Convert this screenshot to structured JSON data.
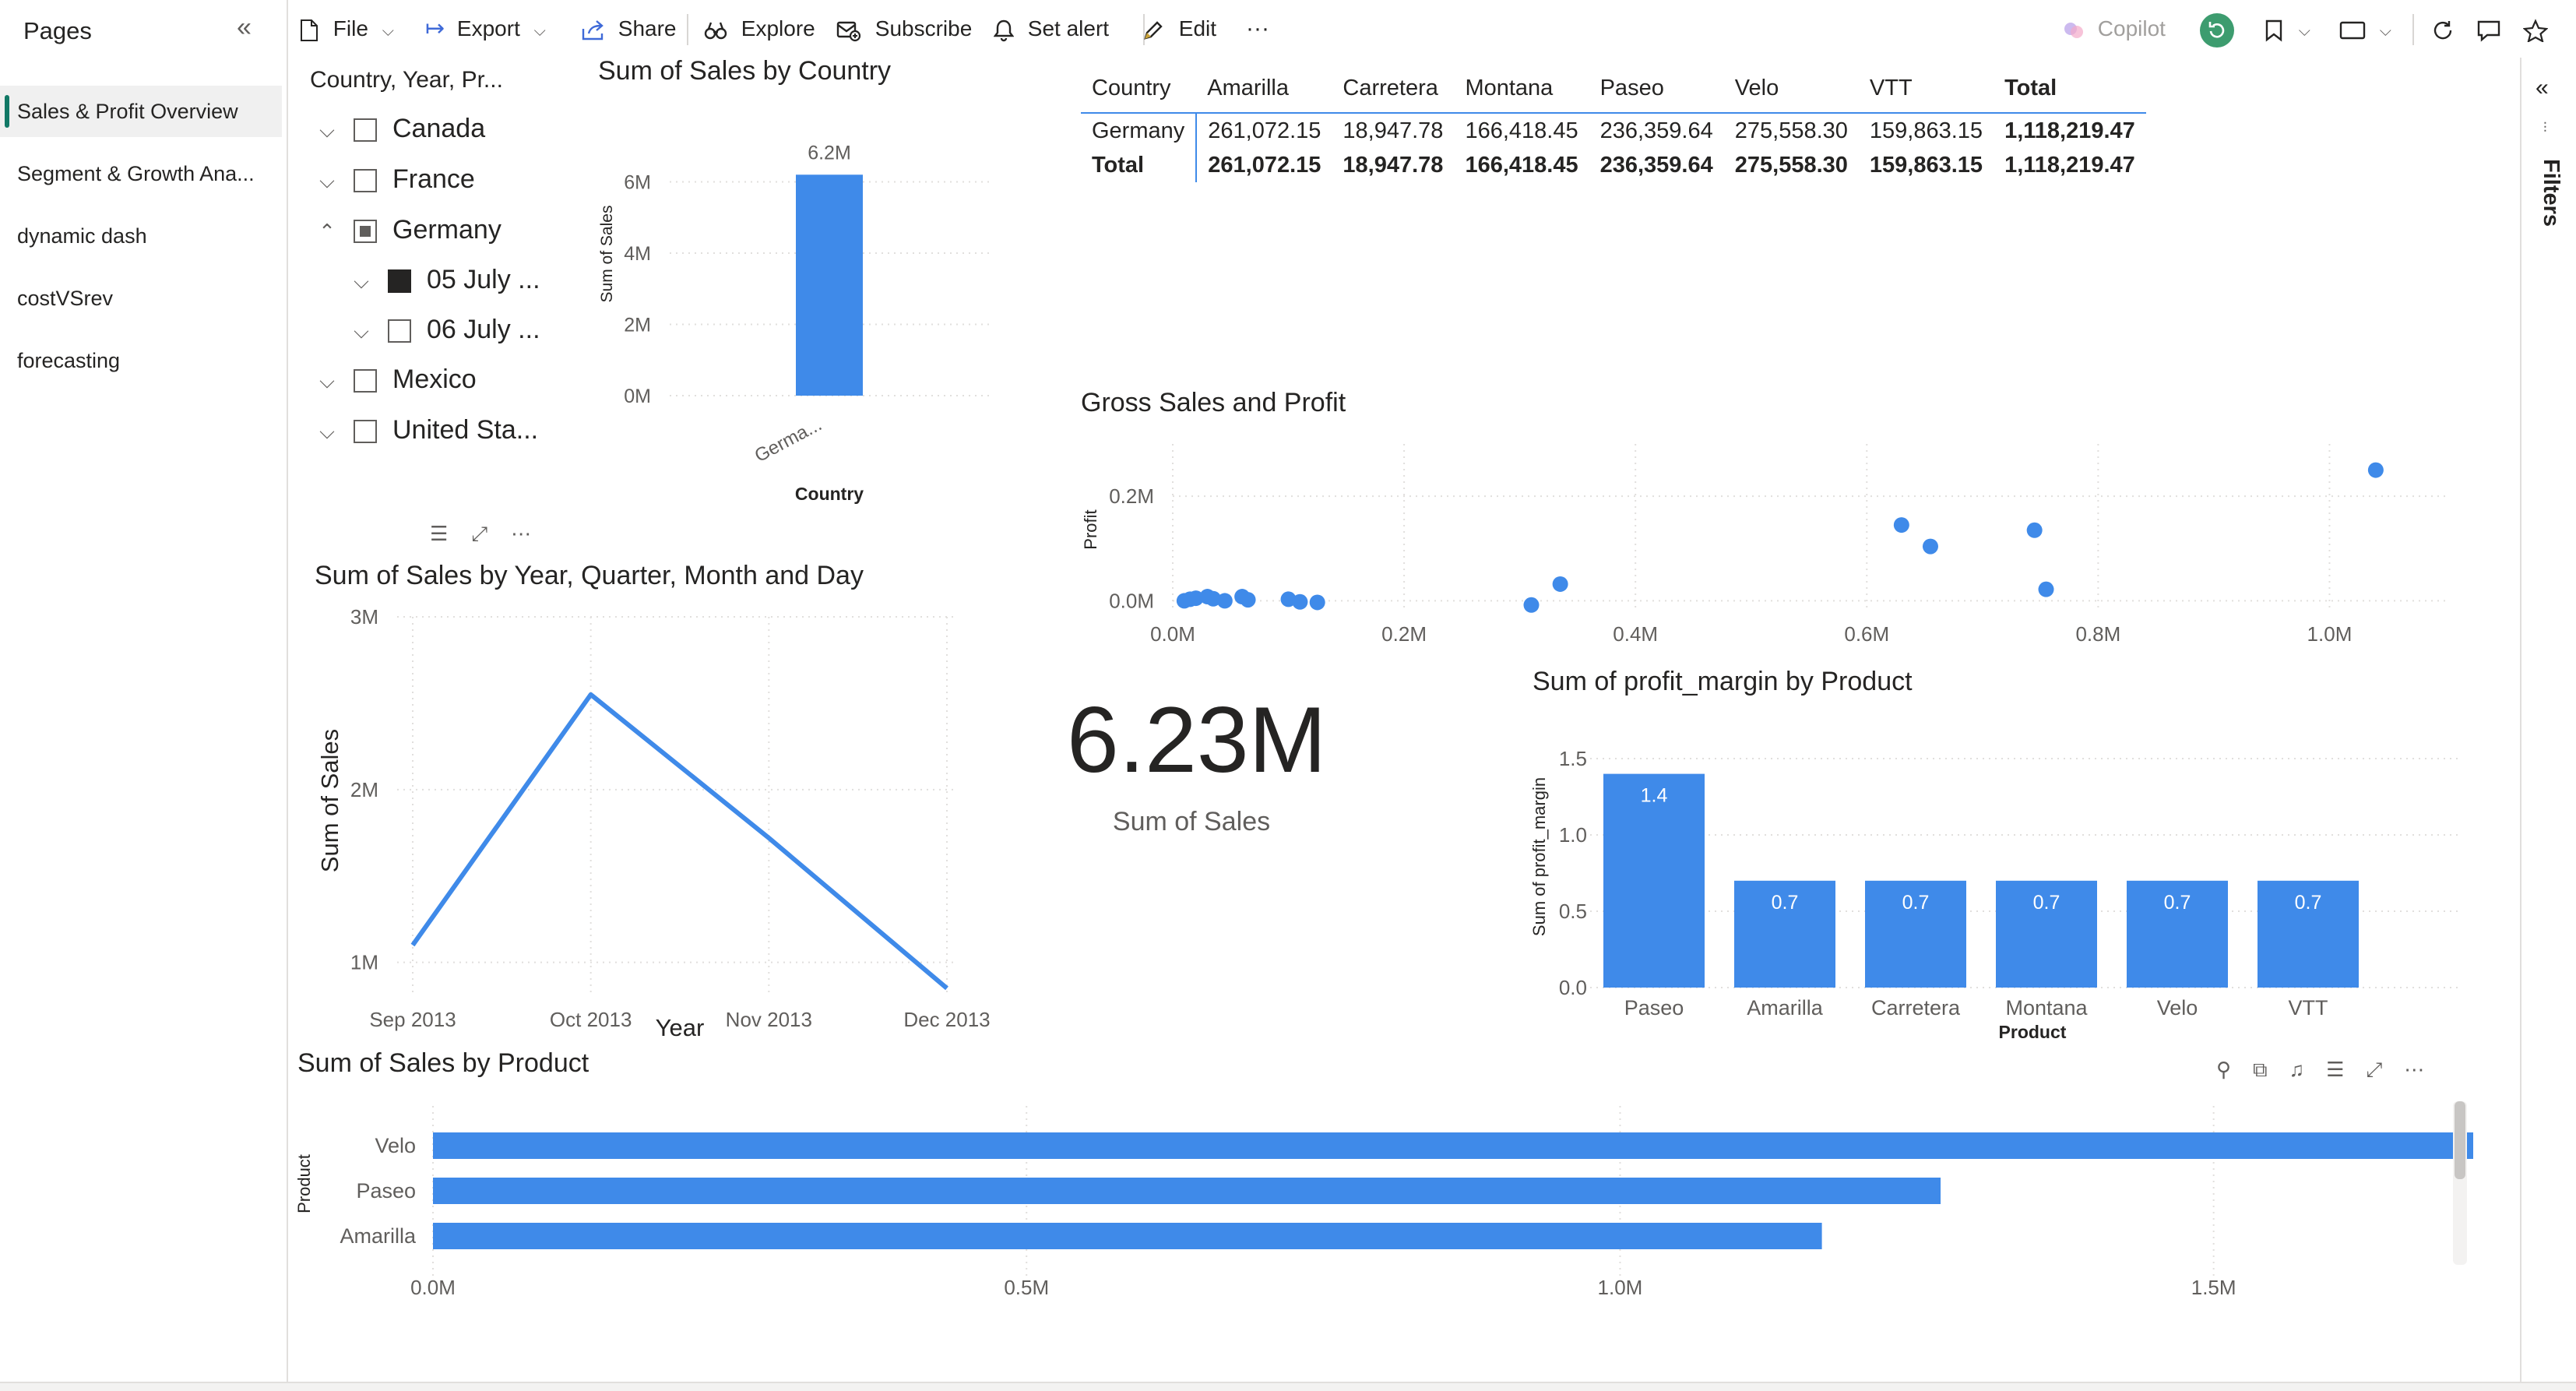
{
  "sidebar": {
    "title": "Pages",
    "pages": [
      {
        "label": "Sales & Profit Overview",
        "active": true
      },
      {
        "label": "Segment & Growth Ana...",
        "active": false
      },
      {
        "label": "dynamic dash",
        "active": false
      },
      {
        "label": "costVSrev",
        "active": false
      },
      {
        "label": "forecasting",
        "active": false
      }
    ]
  },
  "toolbar": {
    "file": "File",
    "export": "Export",
    "share": "Share",
    "explore": "Explore",
    "subscribe": "Subscribe",
    "set_alert": "Set alert",
    "edit": "Edit",
    "more": "···",
    "copilot": "Copilot"
  },
  "filters_pane": {
    "label": "Filters"
  },
  "slicer": {
    "header": "Country, Year, Pr...",
    "items": [
      {
        "label": "Canada",
        "level": 0,
        "expanded": false,
        "state": "unchecked"
      },
      {
        "label": "France",
        "level": 0,
        "expanded": false,
        "state": "unchecked"
      },
      {
        "label": "Germany",
        "level": 0,
        "expanded": true,
        "state": "partial"
      },
      {
        "label": "05 July ...",
        "level": 1,
        "expanded": false,
        "state": "checked"
      },
      {
        "label": "06 July ...",
        "level": 1,
        "expanded": false,
        "state": "unchecked"
      },
      {
        "label": "Mexico",
        "level": 0,
        "expanded": false,
        "state": "unchecked"
      },
      {
        "label": "United Sta...",
        "level": 0,
        "expanded": false,
        "state": "unchecked"
      }
    ]
  },
  "matrix": {
    "columns": [
      "Country",
      "Amarilla",
      "Carretera",
      "Montana",
      "Paseo",
      "Velo",
      "VTT",
      "Total"
    ],
    "rows": [
      [
        "Germany",
        "261,072.15",
        "18,947.78",
        "166,418.45",
        "236,359.64",
        "275,558.30",
        "159,863.15",
        "1,118,219.47"
      ]
    ],
    "total_row": [
      "Total",
      "261,072.15",
      "18,947.78",
      "166,418.45",
      "236,359.64",
      "275,558.30",
      "159,863.15",
      "1,118,219.47"
    ]
  },
  "card": {
    "value": "6.23M",
    "label": "Sum of  Sales"
  },
  "visual_header_icons": [
    "filter-icon",
    "focus-mode-icon",
    "more-options-icon"
  ],
  "bottom_visual_icons": [
    "pin-icon",
    "copy-icon",
    "alert-bell-icon",
    "filter-icon",
    "focus-mode-icon",
    "more-options-icon"
  ],
  "colors": {
    "accent": "#3f8ae9",
    "active_page": "#117865",
    "copilot_green": "#3d9c6f"
  },
  "chart_data": [
    {
      "id": "sales_by_country",
      "type": "bar",
      "title": "Sum of Sales by Country",
      "xlabel": "Country",
      "ylabel": "Sum of Sales",
      "categories": [
        "Germa..."
      ],
      "values": [
        6.2
      ],
      "data_labels": [
        "6.2M"
      ],
      "yticks": [
        "0M",
        "2M",
        "4M",
        "6M"
      ],
      "ylim": [
        0,
        6.6
      ]
    },
    {
      "id": "sales_by_date",
      "type": "line",
      "title": "Sum of Sales by Year, Quarter, Month and Day",
      "xlabel": "Year",
      "ylabel": "Sum of Sales",
      "categories": [
        "Sep 2013",
        "Oct 2013",
        "Nov 2013",
        "Dec 2013"
      ],
      "values": [
        1.1,
        2.55,
        1.72,
        0.85
      ],
      "yticks": [
        "1M",
        "2M",
        "3M"
      ],
      "ylim": [
        0.8,
        3.0
      ]
    },
    {
      "id": "gross_sales_profit",
      "type": "scatter",
      "title": "Gross Sales and Profit",
      "ylabel": "Profit",
      "xticks": [
        "0.0M",
        "0.2M",
        "0.4M",
        "0.6M",
        "0.8M",
        "1.0M"
      ],
      "yticks": [
        "0.0M",
        "0.2M"
      ],
      "xlim": [
        0,
        1.1
      ],
      "ylim": [
        -0.05,
        0.3
      ],
      "points": [
        [
          0.01,
          0.0
        ],
        [
          0.015,
          0.003
        ],
        [
          0.02,
          0.005
        ],
        [
          0.03,
          0.008
        ],
        [
          0.035,
          0.004
        ],
        [
          0.045,
          0.0
        ],
        [
          0.06,
          0.008
        ],
        [
          0.065,
          0.002
        ],
        [
          0.1,
          0.003
        ],
        [
          0.11,
          -0.002
        ],
        [
          0.125,
          -0.003
        ],
        [
          0.31,
          -0.008
        ],
        [
          0.335,
          0.032
        ],
        [
          0.63,
          0.145
        ],
        [
          0.655,
          0.104
        ],
        [
          0.745,
          0.135
        ],
        [
          0.755,
          0.022
        ],
        [
          1.04,
          0.25
        ]
      ]
    },
    {
      "id": "profit_margin_by_product",
      "type": "bar",
      "title": "Sum of profit_margin by Product",
      "xlabel": "Product",
      "ylabel": "Sum of profit_margin",
      "categories": [
        "Paseo",
        "Amarilla",
        "Carretera",
        "Montana",
        "Velo",
        "VTT"
      ],
      "values": [
        1.4,
        0.7,
        0.7,
        0.7,
        0.7,
        0.7
      ],
      "data_labels": [
        "1.4",
        "0.7",
        "0.7",
        "0.7",
        "0.7",
        "0.7"
      ],
      "yticks": [
        "0.0",
        "0.5",
        "1.0",
        "1.5"
      ],
      "ylim": [
        0,
        1.5
      ]
    },
    {
      "id": "sales_by_product",
      "type": "bar",
      "orientation": "horizontal",
      "title": "Sum of Sales by Product",
      "ylabel": "Product",
      "categories": [
        "Velo",
        "Paseo",
        "Amarilla"
      ],
      "values": [
        1.79,
        1.27,
        1.17
      ],
      "xticks": [
        "0.0M",
        "0.5M",
        "1.0M",
        "1.5M"
      ],
      "xlim": [
        0,
        1.8
      ]
    }
  ]
}
